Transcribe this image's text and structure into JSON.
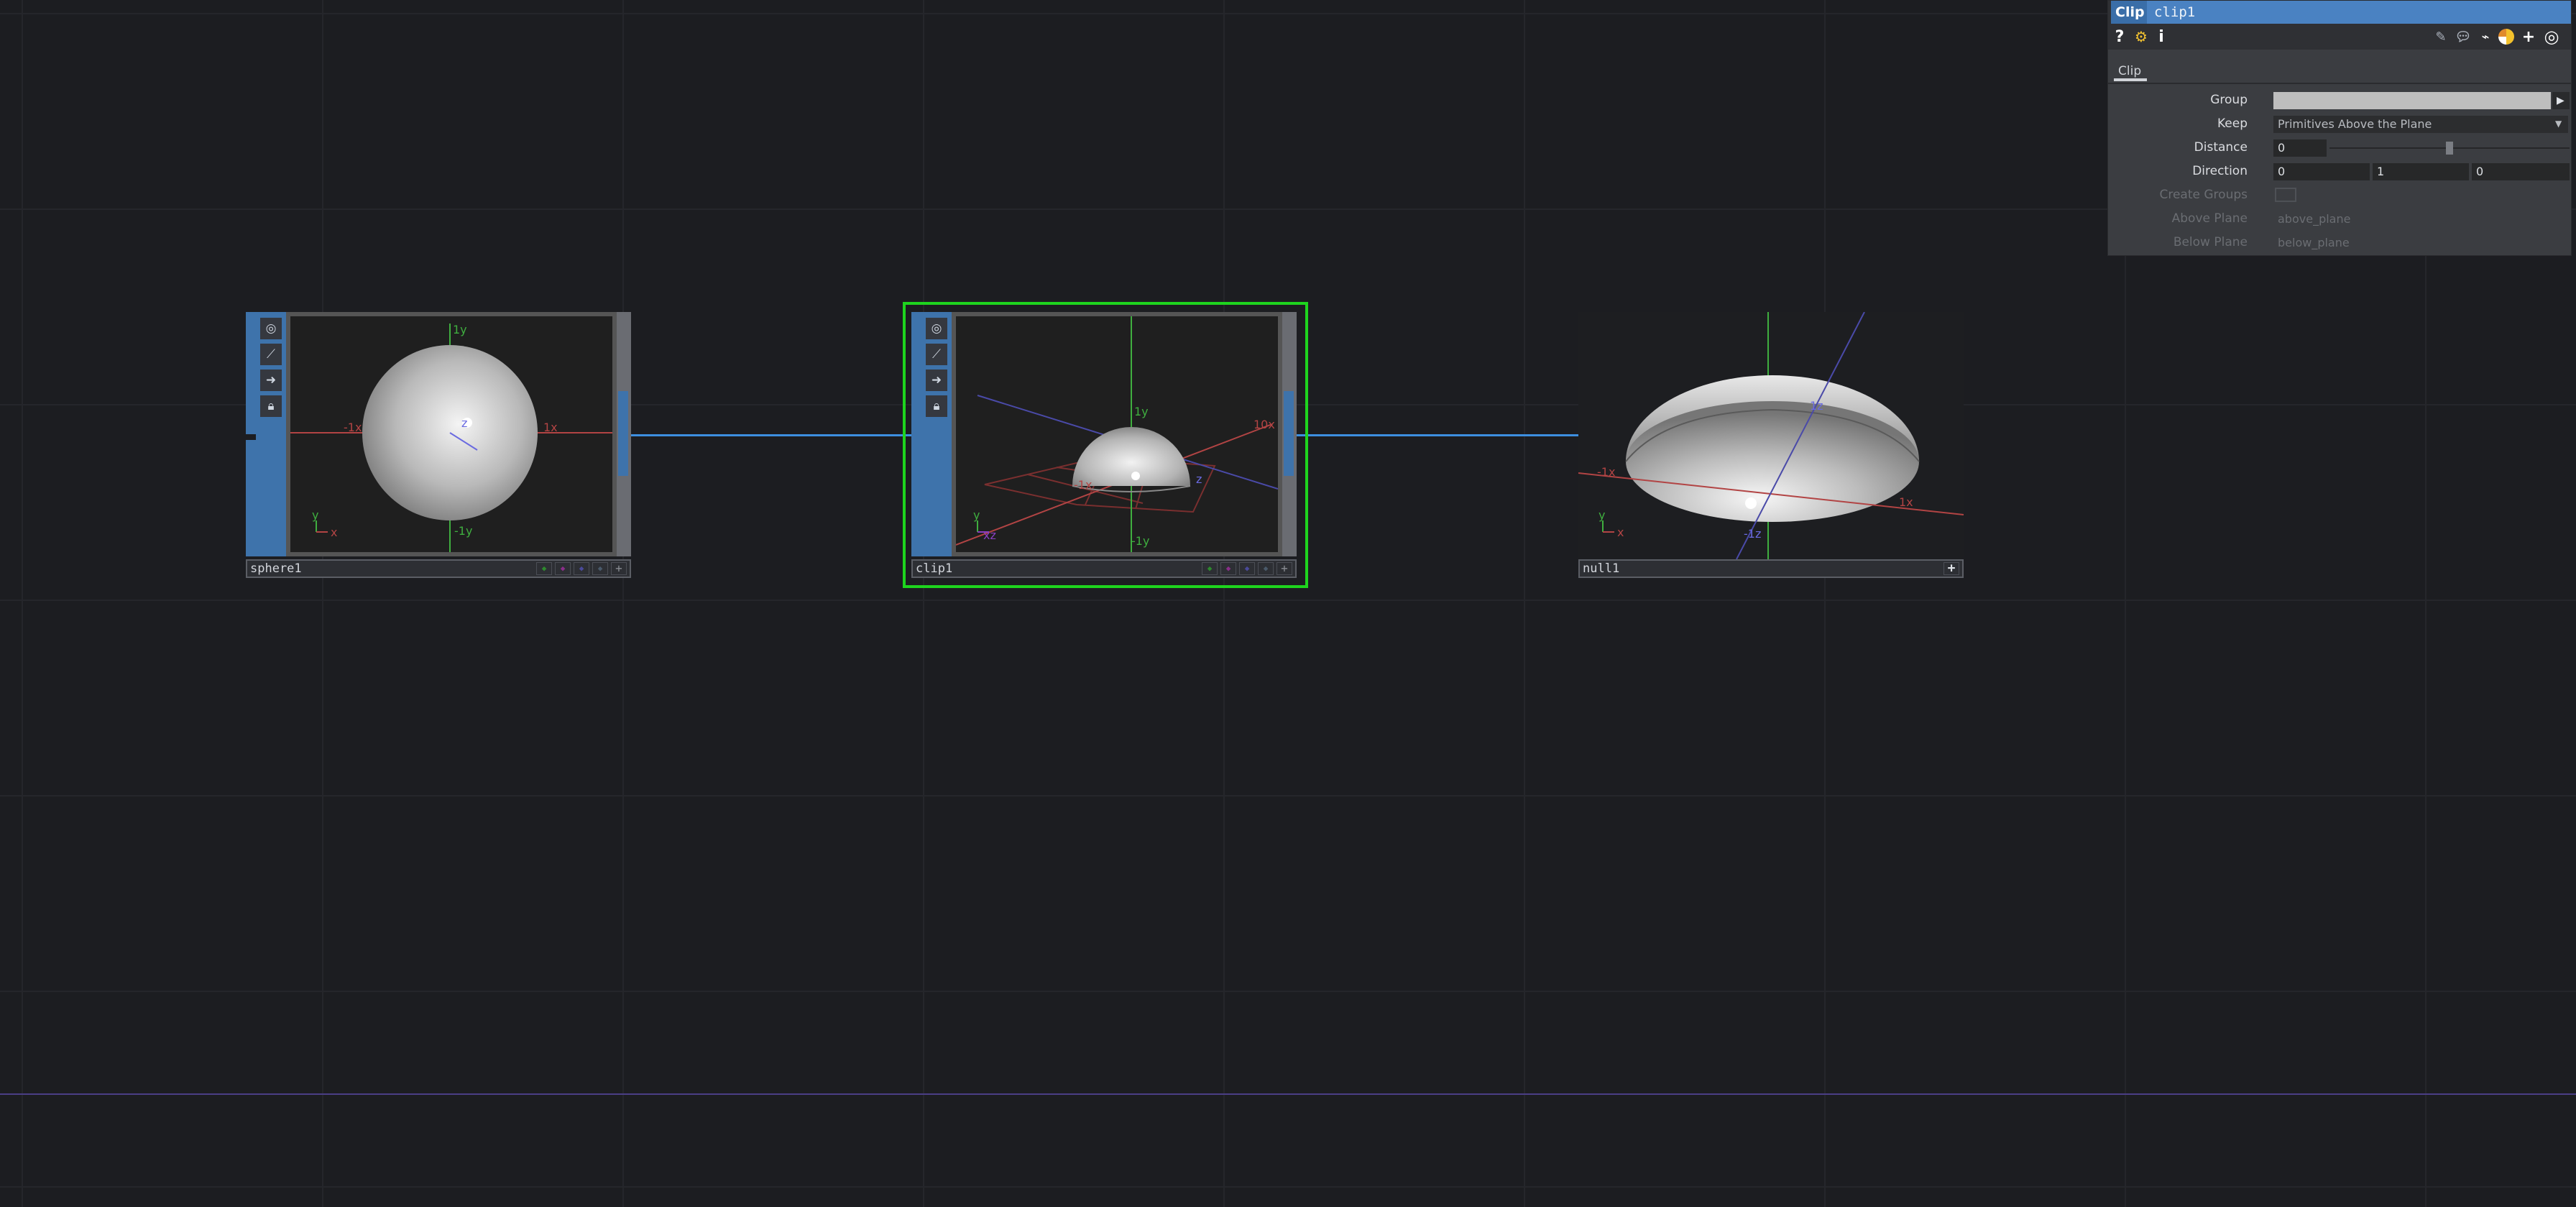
{
  "network": {
    "nodes": [
      {
        "name": "sphere1",
        "axes": {
          "top": "1y",
          "bottom": "-1y",
          "left": "-1x",
          "right": "1x",
          "center": "z",
          "gizmo_y": "y",
          "gizmo_x": "x"
        }
      },
      {
        "name": "clip1",
        "axes": {
          "top": "1y",
          "bottom": "-1y",
          "left": "-1x",
          "right": "10x",
          "center": "z",
          "gizmo_y": "y",
          "gizmo_x": "xz"
        }
      },
      {
        "name": "null1",
        "axes": {
          "top": "1z",
          "bottom": "-1z",
          "left": "-1x",
          "right": "1x",
          "gizmo_y": "y",
          "gizmo_x": "x"
        }
      }
    ],
    "node_controls": [
      "target-icon",
      "graph-icon",
      "arrow-icon",
      "lock-icon"
    ],
    "add_label": "+"
  },
  "panel": {
    "op_type": "Clip",
    "op_name": "clip1",
    "help_icon": "?",
    "info_icon": "i",
    "tab": "Clip",
    "params": {
      "group_label": "Group",
      "group_value": "",
      "keep_label": "Keep",
      "keep_value": "Primitives Above the Plane",
      "distance_label": "Distance",
      "distance_value": "0",
      "direction_label": "Direction",
      "direction_x": "0",
      "direction_y": "1",
      "direction_z": "0",
      "create_groups_label": "Create Groups",
      "above_plane_label": "Above Plane",
      "above_plane_value": "above_plane",
      "below_plane_label": "Below Plane",
      "below_plane_value": "below_plane"
    }
  },
  "colors": {
    "background": "#1c1d21",
    "selection": "#1ed41e",
    "wire": "#3d8fe0",
    "node_strip": "#3e73ab",
    "axis_x": "#b24444",
    "axis_y": "#3fae3f",
    "axis_z": "#6a6ae0"
  }
}
